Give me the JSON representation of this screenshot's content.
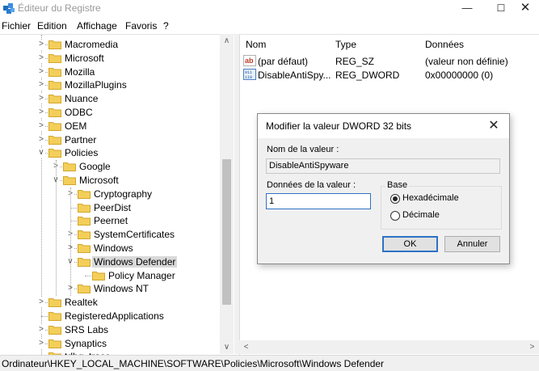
{
  "window": {
    "title": "Éditeur du Registre"
  },
  "menu": [
    "Fichier",
    "Edition",
    "Affichage",
    "Favoris",
    "?"
  ],
  "tree": {
    "items": [
      {
        "label": "Macromedia",
        "level": 1,
        "expander": "collapsed"
      },
      {
        "label": "Microsoft",
        "level": 1,
        "expander": "collapsed"
      },
      {
        "label": "Mozilla",
        "level": 1,
        "expander": "collapsed"
      },
      {
        "label": "MozillaPlugins",
        "level": 1,
        "expander": "collapsed"
      },
      {
        "label": "Nuance",
        "level": 1,
        "expander": "collapsed"
      },
      {
        "label": "ODBC",
        "level": 1,
        "expander": "collapsed"
      },
      {
        "label": "OEM",
        "level": 1,
        "expander": "collapsed"
      },
      {
        "label": "Partner",
        "level": 1,
        "expander": "collapsed"
      },
      {
        "label": "Policies",
        "level": 1,
        "expander": "expanded"
      },
      {
        "label": "Google",
        "level": 2,
        "expander": "collapsed"
      },
      {
        "label": "Microsoft",
        "level": 2,
        "expander": "expanded"
      },
      {
        "label": "Cryptography",
        "level": 3,
        "expander": "collapsed"
      },
      {
        "label": "PeerDist",
        "level": 3,
        "expander": "none"
      },
      {
        "label": "Peernet",
        "level": 3,
        "expander": "none"
      },
      {
        "label": "SystemCertificates",
        "level": 3,
        "expander": "collapsed"
      },
      {
        "label": "Windows",
        "level": 3,
        "expander": "collapsed"
      },
      {
        "label": "Windows Defender",
        "level": 3,
        "expander": "expanded",
        "selected": true
      },
      {
        "label": "Policy Manager",
        "level": 4,
        "expander": "none"
      },
      {
        "label": "Windows NT",
        "level": 3,
        "expander": "collapsed"
      },
      {
        "label": "Realtek",
        "level": 1,
        "expander": "collapsed"
      },
      {
        "label": "RegisteredApplications",
        "level": 1,
        "expander": "none"
      },
      {
        "label": "SRS Labs",
        "level": 1,
        "expander": "collapsed"
      },
      {
        "label": "Synaptics",
        "level": 1,
        "expander": "collapsed"
      },
      {
        "label": "tdbg_trace",
        "level": 1,
        "expander": "none"
      }
    ]
  },
  "list": {
    "headers": {
      "name": "Nom",
      "type": "Type",
      "data": "Données"
    },
    "rows": [
      {
        "icon": "string-value-icon",
        "name": "(par défaut)",
        "type": "REG_SZ",
        "data": "(valeur non définie)"
      },
      {
        "icon": "dword-value-icon",
        "name": "DisableAntiSpy...",
        "type": "REG_DWORD",
        "data": "0x00000000 (0)"
      }
    ]
  },
  "status": {
    "path": "Ordinateur\\HKEY_LOCAL_MACHINE\\SOFTWARE\\Policies\\Microsoft\\Windows Defender"
  },
  "dialog": {
    "title": "Modifier la valeur DWORD 32 bits",
    "name_label": "Nom de la valeur :",
    "name_value": "DisableAntiSpyware",
    "data_label": "Données de la valeur :",
    "data_value": "1",
    "base_label": "Base",
    "radio_hex": "Hexadécimale",
    "radio_dec": "Décimale",
    "selected_base": "Hexadécimale",
    "ok_label": "OK",
    "cancel_label": "Annuler"
  }
}
